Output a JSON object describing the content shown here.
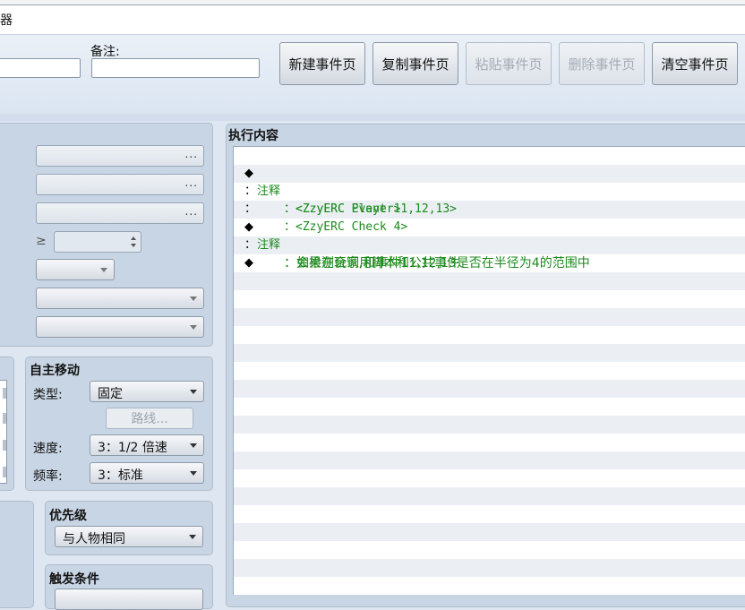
{
  "window": {
    "title": "器"
  },
  "header": {
    "note_label": "备注:",
    "buttons": [
      {
        "label": "新建事件页",
        "enabled": true
      },
      {
        "label": "复制事件页",
        "enabled": true
      },
      {
        "label": "粘贴事件页",
        "enabled": false
      },
      {
        "label": "删除事件页",
        "enabled": false
      },
      {
        "label": "清空事件页",
        "enabled": true
      }
    ]
  },
  "conditions": {
    "dots": "...",
    "gte_symbol": "≥"
  },
  "autonomous_movement": {
    "title": "自主移动",
    "type_label": "类型:",
    "type_value": "固定",
    "route_button": "路线...",
    "speed_label": "速度:",
    "speed_value": "3：1/2 倍速",
    "frequency_label": "频率:",
    "frequency_value": "3：标准"
  },
  "priority": {
    "title": "优先级",
    "value": "与人物相同"
  },
  "trigger": {
    "title": "触发条件"
  },
  "execution": {
    "title": "执行内容",
    "lines": [
      {
        "marker": "◆",
        "keyword": "注释",
        "text": "：<ZzyERC Player>"
      },
      {
        "marker": "：",
        "keyword": "",
        "text": "：<ZzyERC Event 11,12,13>"
      },
      {
        "marker": "：",
        "keyword": "",
        "text": "：<ZzyERC Check 4>"
      },
      {
        "marker": "◆",
        "keyword": "注释",
        "text": "：会检测玩家,和事件11,12,13是否在半径为4的范围中"
      },
      {
        "marker": "：",
        "keyword": "",
        "text": "：如果在会调用脚本和公共事件"
      },
      {
        "marker": "◆",
        "keyword": "",
        "text": ""
      }
    ]
  }
}
